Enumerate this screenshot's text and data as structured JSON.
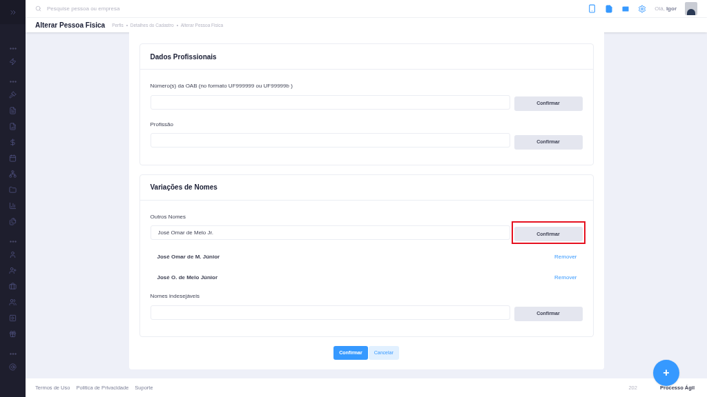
{
  "topbar": {
    "search": {
      "placeholder": "Pesquise pessoa ou empresa"
    },
    "greeting": "Olá,",
    "user": "Igor"
  },
  "subheader": {
    "title": "Alterar Pessoa Fisica",
    "breadcrumbs": [
      "Perfis",
      "Detalhes do Cadastro",
      "Alterar Pessoa Fisica"
    ]
  },
  "sections": [
    {
      "title": "Dados Profissionais",
      "fields": [
        {
          "kind": "input",
          "label": "Número(s) da OAB (no formato UF999999 ou UF99999b )",
          "button": "Confirmar",
          "highlighted": false
        },
        {
          "kind": "input",
          "label": "Profissão",
          "button": "Confirmar",
          "highlighted": false
        }
      ]
    },
    {
      "title": "Variações de Nomes",
      "fields": [
        {
          "kind": "input",
          "label": "Outros Nomes",
          "value": "José Omar de Melo Jr.",
          "button": "Confirmar",
          "highlighted": true
        },
        {
          "kind": "entry",
          "name": "José Omar de M. Júnior",
          "action": "Remover"
        },
        {
          "kind": "entry",
          "name": "José O. de Melo Júnior",
          "action": "Remover"
        },
        {
          "kind": "input",
          "label": "Nomes indesejáveis",
          "button": "Confirmar",
          "highlighted": false
        }
      ]
    }
  ],
  "actions": {
    "confirm": "Confirmar",
    "cancel": "Cancelar"
  },
  "footer": {
    "links": [
      "Termos de Uso",
      "Politica de Privacidade",
      "Suporte"
    ],
    "copyright": "202",
    "brand": "Processo Ágil"
  },
  "fab": "+"
}
